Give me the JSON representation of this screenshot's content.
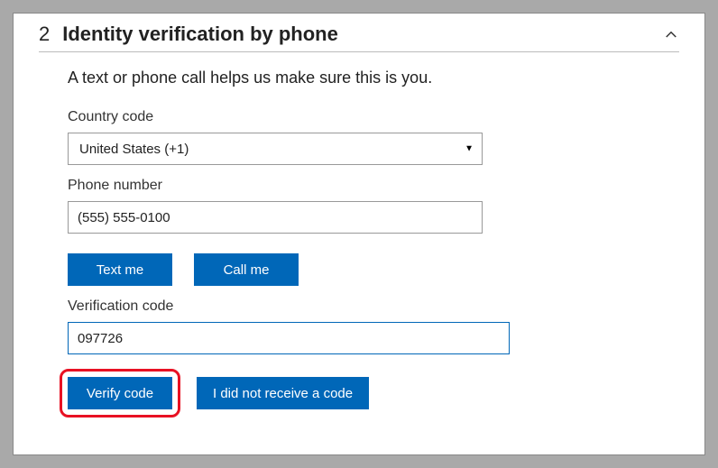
{
  "header": {
    "step": "2",
    "title": "Identity verification by phone"
  },
  "subtitle": "A text or phone call helps us make sure this is you.",
  "country": {
    "label": "Country code",
    "value": "United States (+1)"
  },
  "phone": {
    "label": "Phone number",
    "value": "(555) 555-0100"
  },
  "buttons": {
    "text_me": "Text me",
    "call_me": "Call me",
    "verify": "Verify code",
    "no_code": "I did not receive a code"
  },
  "verification": {
    "label": "Verification code",
    "value": "097726"
  }
}
